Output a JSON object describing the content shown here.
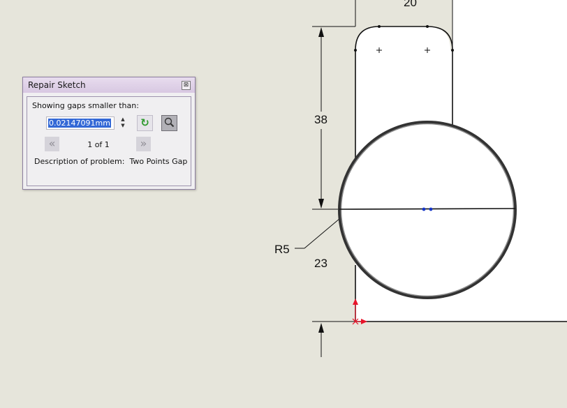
{
  "dialog": {
    "title": "Repair Sketch",
    "close_glyph": "⊠",
    "gaps_label": "Showing gaps smaller than:",
    "gap_value": "0.02147091mm",
    "spin_up": "▲",
    "spin_down": "▼",
    "refresh_glyph": "↻",
    "prev_glyph": "«",
    "next_glyph": "»",
    "pager": "1 of 1",
    "description_label": "Description of problem:",
    "description_value": "Two Points Gap"
  },
  "drawing": {
    "dim_top_width": "20",
    "dim_height_upper": "38",
    "dim_radius": "R5",
    "dim_height_lower": "23"
  },
  "icons": {
    "refresh": "refresh-icon",
    "zoom": "magnifier-icon",
    "origin": "origin-icon"
  },
  "colors": {
    "background": "#e6e5db",
    "selection": "#3368d6",
    "origin": "#e8142a",
    "point": "#1536c8"
  }
}
